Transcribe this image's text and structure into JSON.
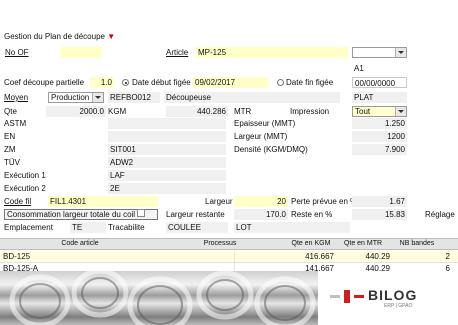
{
  "title": "Gestion du Plan de découpe",
  "no_of": {
    "label": "No OF",
    "value": ""
  },
  "article": {
    "label": "Article",
    "value": "MP-125",
    "select_value": "",
    "code": "A1"
  },
  "coef": {
    "label": "Coef découpe partielle",
    "value": "1.0"
  },
  "date_debut": {
    "label": "Date début figée",
    "value": "09/02/2017",
    "selected": true
  },
  "date_fin": {
    "label": "Date fin figée",
    "value": "00/00/0000",
    "selected": false
  },
  "moyen": {
    "label": "Moyen",
    "type": "Production",
    "code": "REFBO012",
    "name": "Découpeuse",
    "shape": "PLAT"
  },
  "qte": {
    "label": "Qte",
    "value": "2000.0",
    "unit1": "KGM",
    "value2": "440.286",
    "unit2": "MTR"
  },
  "impression": {
    "label": "Impression",
    "value": "Tout"
  },
  "astm": {
    "label": "ASTM",
    "value": ""
  },
  "en": {
    "label": "EN",
    "value": ""
  },
  "zm": {
    "label": "ZM",
    "value": "SIT001"
  },
  "tuv": {
    "label": "TÜV",
    "value": "ADW2"
  },
  "exec1": {
    "label": "Exécution 1",
    "value": "LAF"
  },
  "exec2": {
    "label": "Exécution 2",
    "value": "2E"
  },
  "epaisseur": {
    "label": "Epaisseur (MMT)",
    "value": "1.250"
  },
  "largeur_mmt": {
    "label": "Largeur (MMT)",
    "value": "1200"
  },
  "densite": {
    "label": "Densité (KGM/DMQ)",
    "value": "7.900"
  },
  "code_fil": {
    "label": "Code fil",
    "value": "FIL1.4301"
  },
  "largeur": {
    "label": "Largeur",
    "value": "20"
  },
  "perte": {
    "label": "Perte prévue en %",
    "value": "1.67"
  },
  "conso_btn": {
    "label": "Consommation largeur totale du coil"
  },
  "largeur_restante": {
    "label": "Largeur restante",
    "value": "170.0"
  },
  "reste": {
    "label": "Reste en %",
    "value": "15.83"
  },
  "reglage": {
    "label": "Réglage"
  },
  "emplacement": {
    "label": "Emplacement",
    "value": "TE"
  },
  "tracabilite": {
    "label": "Tracabilite",
    "value": "COULEE",
    "lot": "LOT"
  },
  "table": {
    "headers": [
      "Code article",
      "Processus",
      "Qte en KGM",
      "Qte en MTR",
      "NB bandes"
    ],
    "rows": [
      {
        "code": "BD-125",
        "processus": "",
        "kgm": "416.667",
        "mtr": "440.29",
        "bandes": "2"
      },
      {
        "code": "BD-125-A",
        "processus": "",
        "kgm": "141.667",
        "mtr": "440.29",
        "bandes": "6"
      }
    ]
  },
  "logo": {
    "text": "BILOG",
    "subtitle": "ERP | GPAO"
  }
}
